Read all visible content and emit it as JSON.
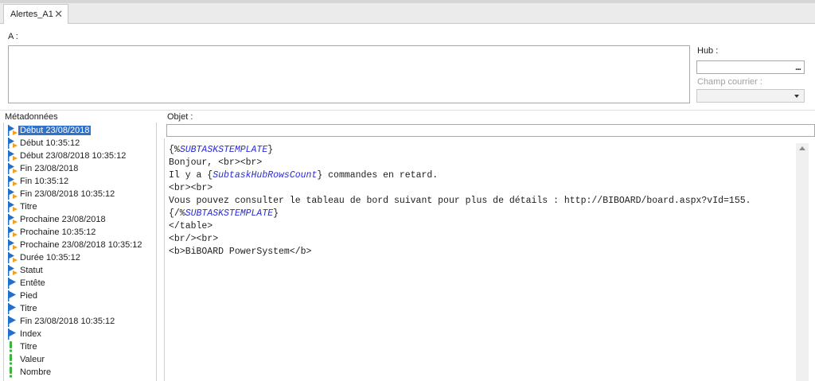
{
  "tab": {
    "title": "Alertes_A1",
    "close_glyph": "✕"
  },
  "recipient": {
    "label": "A :",
    "value": ""
  },
  "hub": {
    "label": "Hub :",
    "value": "",
    "button_glyph": "..."
  },
  "mail_field": {
    "label": "Champ courrier :",
    "value": ""
  },
  "metadata": {
    "label": "Métadonnées",
    "items": [
      {
        "label": "Début 23/08/2018",
        "icon": "flag-date-icon",
        "selected": true
      },
      {
        "label": "Début 10:35:12",
        "icon": "flag-date-icon"
      },
      {
        "label": "Début 23/08/2018 10:35:12",
        "icon": "flag-date-icon"
      },
      {
        "label": "Fin 23/08/2018",
        "icon": "flag-date-icon"
      },
      {
        "label": "Fin 10:35:12",
        "icon": "flag-date-icon"
      },
      {
        "label": "Fin 23/08/2018 10:35:12",
        "icon": "flag-date-icon"
      },
      {
        "label": "Titre",
        "icon": "flag-date-icon"
      },
      {
        "label": "Prochaine 23/08/2018",
        "icon": "flag-date-icon"
      },
      {
        "label": "Prochaine 10:35:12",
        "icon": "flag-date-icon"
      },
      {
        "label": "Prochaine 23/08/2018 10:35:12",
        "icon": "flag-date-icon"
      },
      {
        "label": "Durée 10:35:12",
        "icon": "flag-date-icon"
      },
      {
        "label": "Statut",
        "icon": "flag-date-icon"
      },
      {
        "label": "Entête",
        "icon": "blue-flag-icon"
      },
      {
        "label": "Pied",
        "icon": "blue-flag-icon"
      },
      {
        "label": "Titre",
        "icon": "blue-flag-icon"
      },
      {
        "label": "Fin 23/08/2018 10:35:12",
        "icon": "blue-flag-icon"
      },
      {
        "label": "Index",
        "icon": "blue-flag-icon"
      },
      {
        "label": "Titre",
        "icon": "green-exclamation-icon"
      },
      {
        "label": "Valeur",
        "icon": "green-exclamation-icon"
      },
      {
        "label": "Nombre",
        "icon": "green-exclamation-icon"
      }
    ]
  },
  "subject": {
    "label": "Objet :",
    "value": ""
  },
  "body": {
    "lines": [
      [
        {
          "t": "{%",
          "k": false
        },
        {
          "t": "SUBTASKSTEMPLATE",
          "k": true
        },
        {
          "t": "}",
          "k": false
        }
      ],
      [
        {
          "t": "Bonjour, <br><br>",
          "k": false
        }
      ],
      [
        {
          "t": "Il y a {",
          "k": false
        },
        {
          "t": "SubtaskHubRowsCount",
          "k": true
        },
        {
          "t": "} commandes en retard.",
          "k": false
        }
      ],
      [
        {
          "t": "<br><br>",
          "k": false
        }
      ],
      [
        {
          "t": "Vous pouvez consulter le tableau de bord suivant pour plus de détails : http://BIBOARD/board.aspx?vId=155.",
          "k": false
        }
      ],
      [
        {
          "t": "{/%",
          "k": false
        },
        {
          "t": "SUBTASKSTEMPLATE",
          "k": true
        },
        {
          "t": "}",
          "k": false
        }
      ],
      [
        {
          "t": "</table>",
          "k": false
        }
      ],
      [
        {
          "t": "<br/><br>",
          "k": false
        }
      ],
      [
        {
          "t": "<b>BiBOARD PowerSystem</b>",
          "k": false
        }
      ]
    ]
  },
  "colors": {
    "selection": "#3072c8",
    "keyword": "#2b2bd8",
    "flag_blue": "#1f6fd1",
    "flag_orange": "#f0a020",
    "exclaim_green": "#3ab53a"
  }
}
